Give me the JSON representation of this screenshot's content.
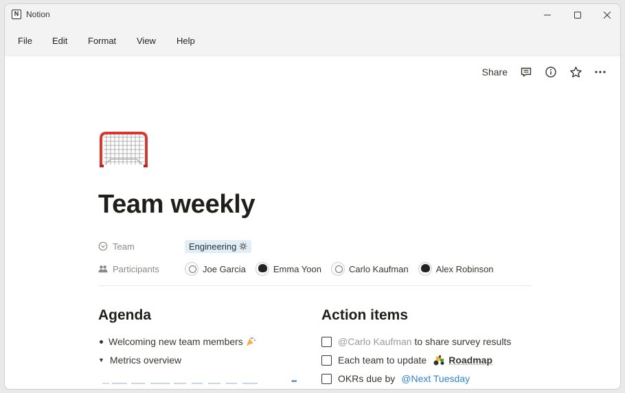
{
  "window": {
    "title": "Notion",
    "app_icon_letter": "N"
  },
  "menu": [
    "File",
    "Edit",
    "Format",
    "View",
    "Help"
  ],
  "topbar": {
    "share_label": "Share"
  },
  "page": {
    "title": "Team weekly",
    "properties": {
      "team": {
        "label": "Team",
        "value": "Engineering"
      },
      "participants": {
        "label": "Participants",
        "people": [
          "Joe Garcia",
          "Emma Yoon",
          "Carlo Kaufman",
          "Alex Robinson"
        ]
      }
    },
    "agenda": {
      "heading": "Agenda",
      "items": [
        "Welcoming new team members",
        "Metrics overview"
      ]
    },
    "action_items": {
      "heading": "Action items",
      "items": [
        {
          "mention": "@Carlo Kaufman",
          "text": " to share survey results"
        },
        {
          "text": "Each team to update",
          "link": "Roadmap"
        },
        {
          "text": "OKRs due by",
          "date": "@Next Tuesday"
        }
      ]
    }
  },
  "colors": {
    "tag_bg": "#e1eef6",
    "mention_blue": "#2f83c8",
    "mention_gray": "#9b9a97",
    "goal_red": "#d8362f"
  }
}
